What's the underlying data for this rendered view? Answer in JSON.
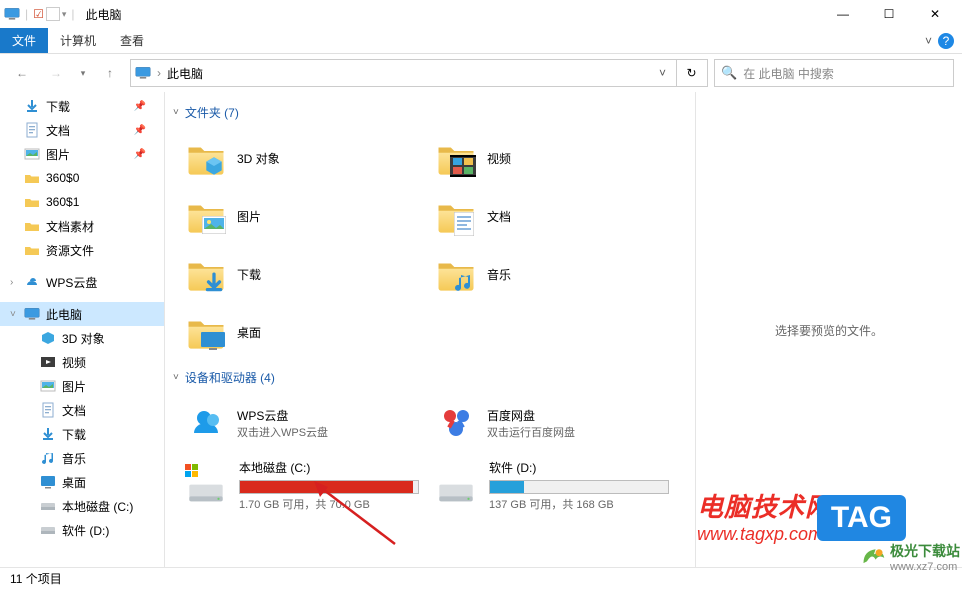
{
  "title": "此电脑",
  "window": {
    "min": "—",
    "max": "☐",
    "close": "✕"
  },
  "ribbon": {
    "file": "文件",
    "tab1": "计算机",
    "tab2": "查看"
  },
  "nav": {
    "addr": "此电脑",
    "searchPlaceholder": "在 此电脑 中搜索"
  },
  "sidebar": [
    {
      "icon": "download",
      "label": "下载",
      "pinned": true
    },
    {
      "icon": "doc",
      "label": "文档",
      "pinned": true
    },
    {
      "icon": "pic",
      "label": "图片",
      "pinned": true
    },
    {
      "icon": "folder",
      "label": "360$0"
    },
    {
      "icon": "folder",
      "label": "360$1"
    },
    {
      "icon": "folder",
      "label": "文档素材"
    },
    {
      "icon": "folder",
      "label": "资源文件"
    },
    {
      "icon": "wps",
      "label": "WPS云盘",
      "top": true
    },
    {
      "icon": "pc",
      "label": "此电脑",
      "top": true,
      "active": true,
      "expanded": true
    },
    {
      "icon": "3d",
      "label": "3D 对象",
      "indent": true
    },
    {
      "icon": "video",
      "label": "视频",
      "indent": true
    },
    {
      "icon": "pic",
      "label": "图片",
      "indent": true
    },
    {
      "icon": "doc",
      "label": "文档",
      "indent": true
    },
    {
      "icon": "download",
      "label": "下载",
      "indent": true
    },
    {
      "icon": "music",
      "label": "音乐",
      "indent": true
    },
    {
      "icon": "desktop",
      "label": "桌面",
      "indent": true
    },
    {
      "icon": "hdd",
      "label": "本地磁盘 (C:)",
      "indent": true
    },
    {
      "icon": "hdd",
      "label": "软件 (D:)",
      "indent": true
    }
  ],
  "groups": {
    "folders": {
      "title": "文件夹 (7)",
      "items": [
        {
          "icon": "3d",
          "label": "3D 对象"
        },
        {
          "icon": "video",
          "label": "视频"
        },
        {
          "icon": "pic",
          "label": "图片"
        },
        {
          "icon": "doc",
          "label": "文档"
        },
        {
          "icon": "download",
          "label": "下载"
        },
        {
          "icon": "music",
          "label": "音乐"
        },
        {
          "icon": "desktop",
          "label": "桌面"
        }
      ]
    },
    "devices": {
      "title": "设备和驱动器 (4)",
      "apps": [
        {
          "icon": "wps",
          "label": "WPS云盘",
          "sub": "双击进入WPS云盘"
        },
        {
          "icon": "baidu",
          "label": "百度网盘",
          "sub": "双击运行百度网盘"
        }
      ],
      "drives": [
        {
          "label": "本地磁盘 (C:)",
          "free": "1.70 GB 可用，共 70.0 GB",
          "fill": 97,
          "color": "#d92a1c"
        },
        {
          "label": "软件 (D:)",
          "free": "137 GB 可用，共 168 GB",
          "fill": 19,
          "color": "#26a0da"
        }
      ]
    }
  },
  "preview": "选择要预览的文件。",
  "status": "11 个项目",
  "watermarks": {
    "a1": "电脑技术网",
    "a2": "www.tagxp.com",
    "b": "TAG",
    "c1": "极光下载站",
    "c2": "www.xz7.com"
  }
}
